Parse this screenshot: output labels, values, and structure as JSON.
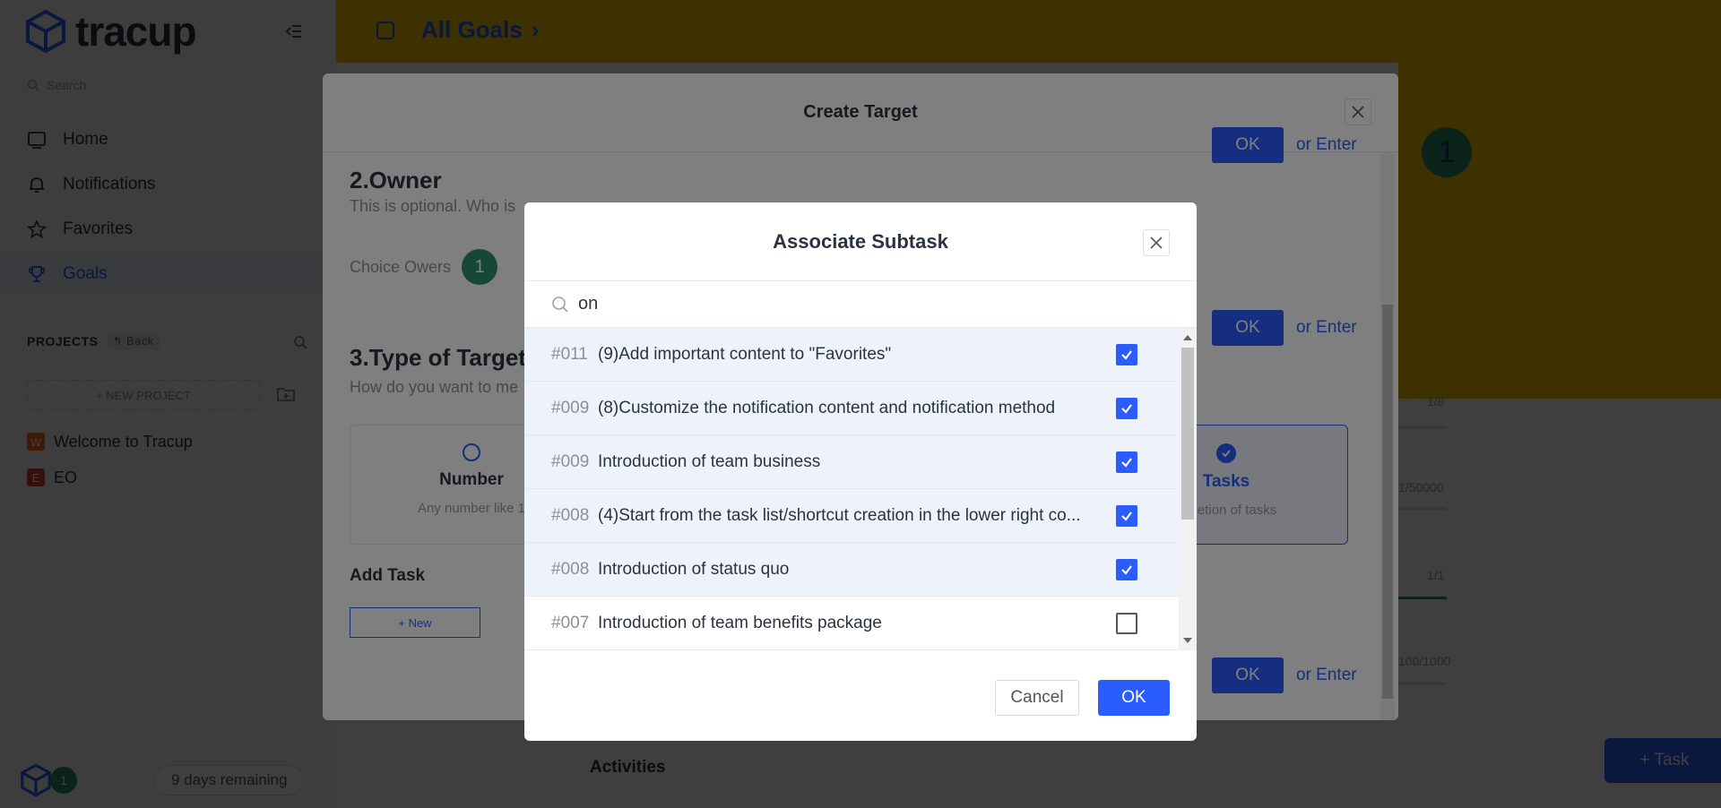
{
  "sidebar": {
    "brand": "tracup",
    "search_placeholder": "Search",
    "nav": [
      {
        "label": "Home"
      },
      {
        "label": "Notifications"
      },
      {
        "label": "Favorites"
      },
      {
        "label": "Goals"
      }
    ],
    "projects_label": "PROJECTS",
    "back_label": "Back",
    "new_project_label": "+ NEW PROJECT",
    "projects": [
      {
        "badge": "W",
        "name": "Welcome to Tracup",
        "color": "#f26b1d"
      },
      {
        "badge": "E",
        "name": "EO",
        "color": "#e23d3d"
      }
    ],
    "avatar_initial": "1",
    "remaining": "9 days remaining"
  },
  "page": {
    "title": "All Goals",
    "badge_count": "1",
    "metrics": [
      "1/8",
      "1/50000",
      "1/1",
      "100/1000"
    ],
    "activities": "Activities",
    "task_button": "+ Task"
  },
  "create_target": {
    "title": "Create Target",
    "owner_title": "2.Owner",
    "owner_sub": "This is optional. Who is",
    "choice_owners": "Choice Owers",
    "owner_count": "1",
    "type_title": "3.Type of Target",
    "type_sub": "How do you want to me",
    "type_number": {
      "name": "Number",
      "desc": "Any number like 1"
    },
    "type_tasks": {
      "name": "Tasks",
      "desc": "mpletion of tasks"
    },
    "add_task": "Add Task",
    "new_label": "+ New",
    "ok_label": "OK",
    "or_enter": "or Enter"
  },
  "associate": {
    "title": "Associate Subtask",
    "search_value": "on",
    "items": [
      {
        "id": "#011",
        "text": "(9)Add important content to \"Favorites\"",
        "checked": true
      },
      {
        "id": "#009",
        "text": "(8)Customize the notification content and notification method",
        "checked": true
      },
      {
        "id": "#009",
        "text": "Introduction of team business",
        "checked": true
      },
      {
        "id": "#008",
        "text": "(4)Start from the task list/shortcut creation in the lower right co...",
        "checked": true
      },
      {
        "id": "#008",
        "text": "Introduction of status quo",
        "checked": true
      },
      {
        "id": "#007",
        "text": "Introduction of team benefits package",
        "checked": false
      }
    ],
    "cancel_label": "Cancel",
    "ok_label": "OK"
  },
  "colors": {
    "accent": "#2a5cff",
    "banner": "#f5c400",
    "owner_green": "#2f8f6b"
  }
}
